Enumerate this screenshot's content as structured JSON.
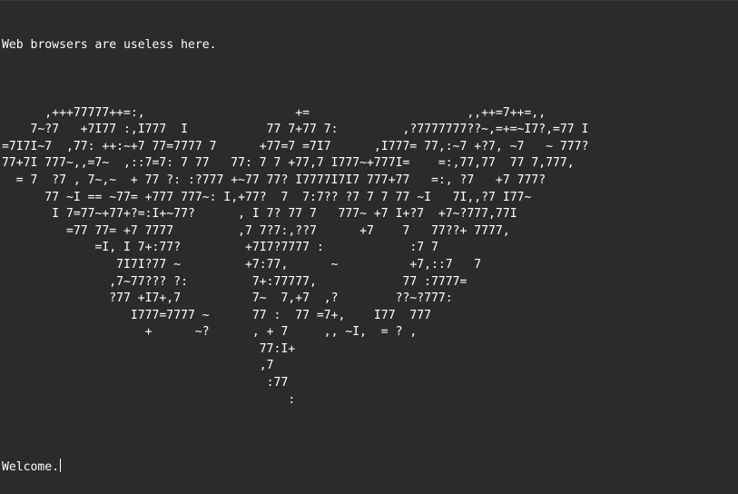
{
  "terminal": {
    "header_text": "Web browsers are useless here.",
    "ascii_art": [
      "",
      "      ,+++77777++=:,                     +=                      ,,++=7++=,,",
      "    7~?7   +7I77 :,I777  I           77 7+77 7:         ,?7777777??~,=+=~I7?,=77 I",
      "=7I7I~7  ,77: ++:~+7 77=7777 7      +77=7 =7I7      ,I777= 77,:~7 +?7, ~7   ~ 777?",
      "77+7I 777~,,=7~  ,::7=7: 7 77   77: 7 7 +77,7 I777~+777I=    =:,77,77  77 7,777,",
      "  = 7  ?7 , 7~,~  + 77 ?: :?777 +~77 77? I7777I7I7 777+77   =:, ?7   +7 777?",
      "      77 ~I == ~77= +777 777~: I,+77?  7  7:7?? ?7 7 7 77 ~I   7I,,?7 I77~",
      "       I 7=77~+77+?=:I+~77?      , I 7? 77 7   777~ +7 I+?7  +7~?777,77I",
      "         =77 77= +7 7777         ,7 7?7:,??7      +7    7   77??+ 7777,",
      "             =I, I 7+:77?         +7I7?7777 :            :7 7",
      "                7I7I?77 ~         +7:77,      ~          +7,::7   7",
      "               ,7~77??? ?:         7+:77777,            77 :7777=",
      "               ?77 +I7+,7          7~  7,+7  ,?        ??~?777:",
      "                  I777=7777 ~      77 :  77 =7+,    I77  777",
      "                    +      ~?      , + 7     ,, ~I,  = ? ,",
      "                                    77:I+",
      "                                    ,7",
      "                                     :77",
      "                                        :"
    ],
    "prompt_text": "Welcome."
  },
  "colors": {
    "background": "#2b2b2b",
    "foreground": "#ffffff"
  }
}
